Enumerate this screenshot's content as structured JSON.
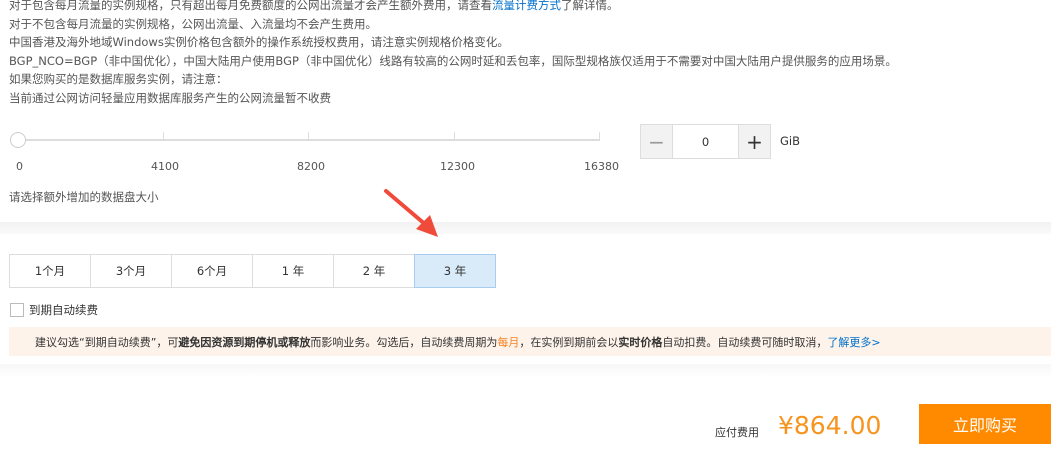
{
  "info": {
    "line1_pre": "对于包含每月流量的实例规格，只有超出每月免费额度的公网出流量才会产生额外费用，请查看",
    "line1_link": "流量计费方式",
    "line1_post": "了解详情。",
    "line2": "对于不包含每月流量的实例规格，公网出流量、入流量均不会产生费用。",
    "line3": "中国香港及海外地域Windows实例价格包含额外的操作系统授权费用，请注意实例规格价格变化。",
    "line4": "BGP_NCO=BGP（非中国优化），中国大陆用户使用BGP（非中国优化）线路有较高的公网时延和丢包率，国际型规格族仅适用于不需要对中国大陆用户提供服务的应用场景。",
    "line5": "如果您购买的是数据库服务实例，请注意：",
    "line6": "当前通过公网访问轻量应用数据库服务产生的公网流量暂不收费"
  },
  "disk": {
    "ticks": [
      "0",
      "4100",
      "8200",
      "12300",
      "16380"
    ],
    "value": "0",
    "min": 0,
    "max": 16380,
    "unit": "GiB",
    "minus": "−",
    "plus": "+",
    "hint": "请选择额外增加的数据盘大小"
  },
  "durations": [
    "1个月",
    "3个月",
    "6个月",
    "1 年",
    "2 年",
    "3 年"
  ],
  "selected_duration": "3 年",
  "auto_renew": {
    "label": "到期自动续费",
    "checked": false
  },
  "notice": {
    "p1": "建议勾选“到期自动续费”，可",
    "b1": "避免因资源到期停机或释放",
    "p2": "而影响业务。勾选后，自动续费周期为 ",
    "monthly": "每月",
    "p3": "，在实例到期前会以",
    "b2": "实时价格",
    "p4": "自动扣费。自动续费可随时取消，",
    "link": "了解更多>"
  },
  "footer": {
    "price_label": "应付费用",
    "price": "¥864.00",
    "buy": "立即购买"
  },
  "colors": {
    "accent": "#ff8a00",
    "link": "#0070cc",
    "selected": "#d9eaf8"
  }
}
